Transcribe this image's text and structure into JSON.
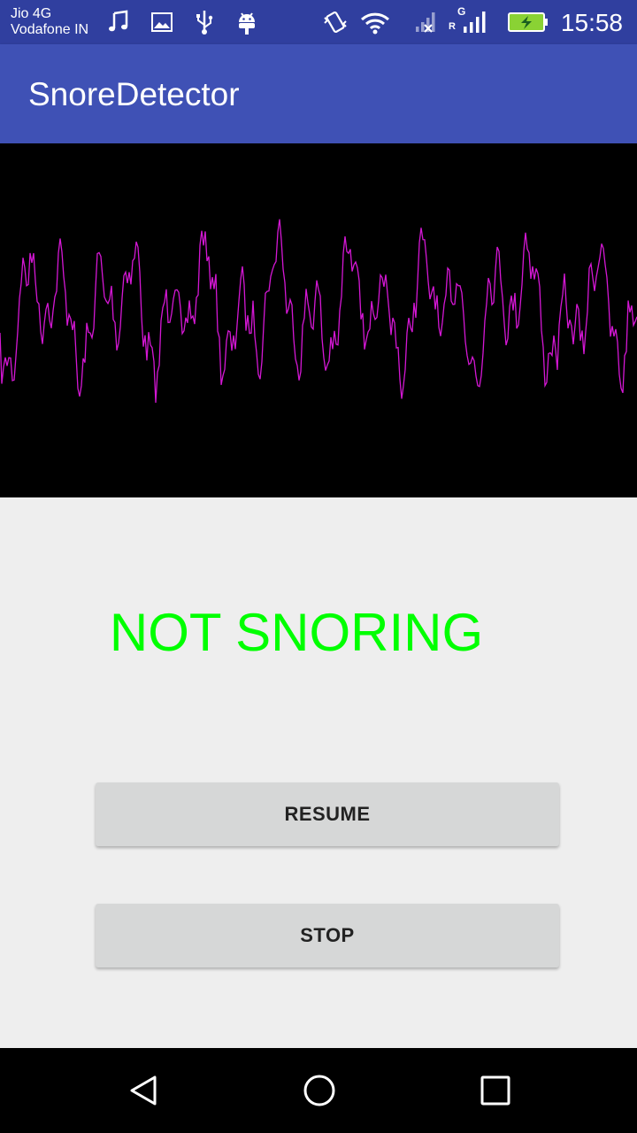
{
  "status_bar": {
    "carrier_1": "Jio 4G",
    "carrier_2": "Vodafone IN",
    "time": "15:58",
    "network_label_top": "G",
    "network_label_bottom": "R",
    "icons": [
      "music-note-icon",
      "image-icon",
      "usb-icon",
      "android-debug-icon",
      "vibrate-icon",
      "wifi-icon",
      "signal-no-sim-icon",
      "signal-roaming-icon",
      "battery-charging-icon"
    ]
  },
  "app_bar": {
    "title": "SnoreDetector"
  },
  "detection": {
    "status": "NOT SNORING",
    "status_color": "#00ff00"
  },
  "waveform": {
    "line_color": "#d417d4",
    "background": "#000000"
  },
  "controls": {
    "resume_label": "RESUME",
    "stop_label": "STOP"
  },
  "nav_bar": {
    "icons": [
      "back-icon",
      "home-icon",
      "recents-icon"
    ]
  }
}
